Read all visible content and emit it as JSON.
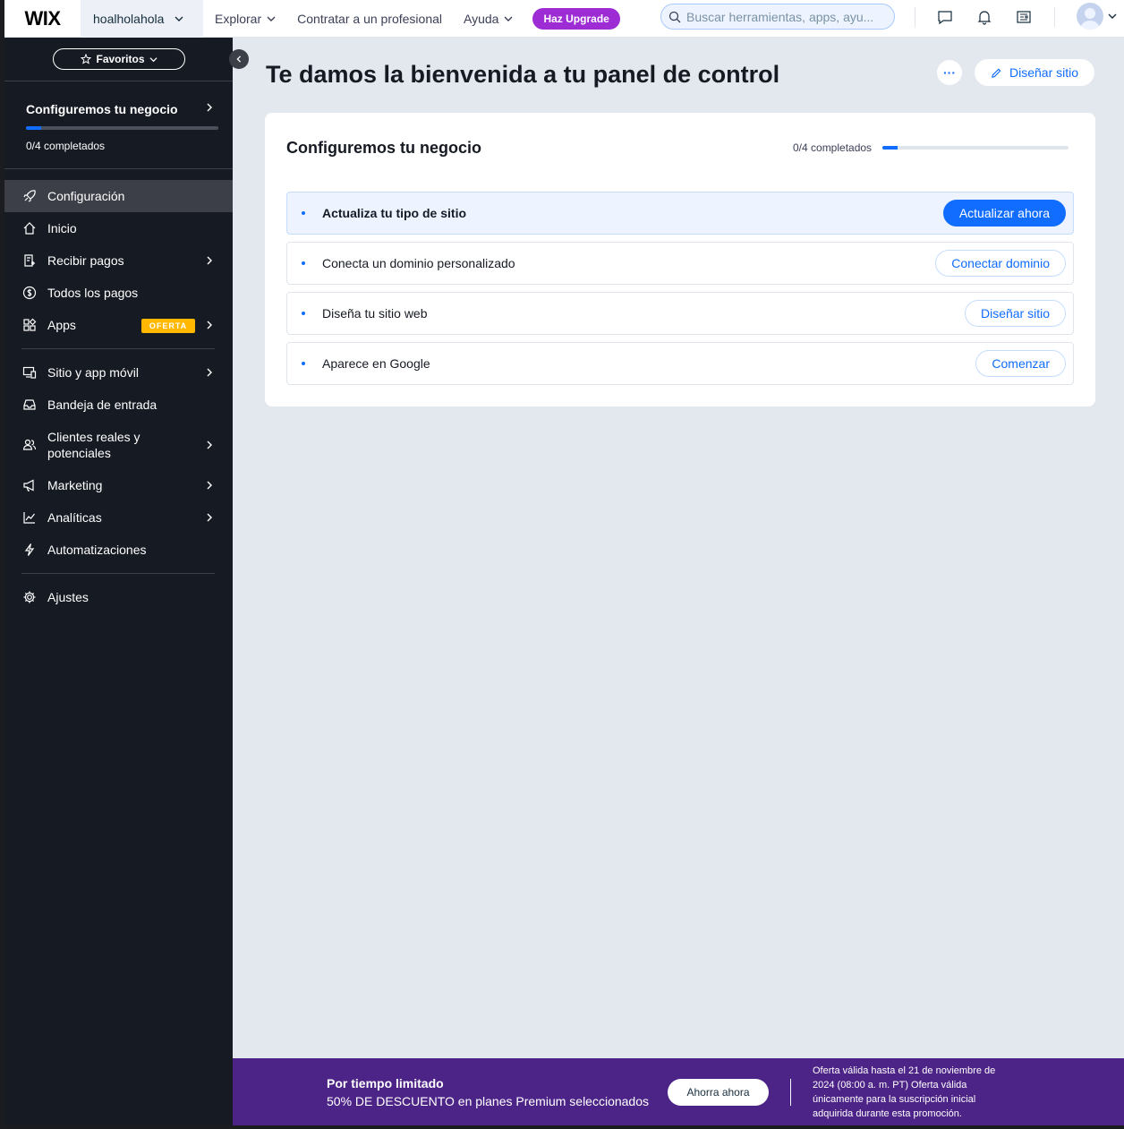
{
  "topbar": {
    "logo": "WIX",
    "site_name": "hoalholahola",
    "nav": [
      "Explorar",
      "Contratar a un profesional",
      "Ayuda"
    ],
    "upgrade_label": "Haz Upgrade",
    "search_placeholder": "Buscar herramientas, apps, ayu..."
  },
  "sidebar": {
    "favorites_label": "Favoritos",
    "setup_title": "Configuremos tu negocio",
    "setup_count": "0/4 completados",
    "setup_progress": 0.08,
    "items": [
      {
        "label": "Configuración",
        "icon": "rocket-icon",
        "active": true,
        "arrow": false
      },
      {
        "label": "Inicio",
        "icon": "home-icon",
        "arrow": false
      },
      {
        "label": "Recibir pagos",
        "icon": "payment-icon",
        "arrow": true
      },
      {
        "label": "Todos los pagos",
        "icon": "dollar-icon",
        "arrow": false
      },
      {
        "label": "Apps",
        "icon": "apps-icon",
        "arrow": true,
        "badge": "OFERTA"
      },
      {
        "label": "Sitio y app móvil",
        "icon": "devices-icon",
        "arrow": true
      },
      {
        "label": "Bandeja de entrada",
        "icon": "inbox-icon",
        "arrow": false
      },
      {
        "label": "Clientes reales y potenciales",
        "icon": "clients-icon",
        "arrow": true
      },
      {
        "label": "Marketing",
        "icon": "megaphone-icon",
        "arrow": true
      },
      {
        "label": "Analíticas",
        "icon": "analytics-icon",
        "arrow": true
      },
      {
        "label": "Automatizaciones",
        "icon": "bolt-icon",
        "arrow": false
      },
      {
        "label": "Ajustes",
        "icon": "gear-icon",
        "arrow": false
      }
    ]
  },
  "main": {
    "title": "Te damos la bienvenida a tu panel de control",
    "more_label": "···",
    "design_button": "Diseñar sitio",
    "card": {
      "title": "Configuremos tu negocio",
      "count": "0/4 completados",
      "progress": 0.08,
      "tasks": [
        {
          "label": "Actualiza tu tipo de sitio",
          "button": "Actualizar ahora",
          "primary": true
        },
        {
          "label": "Conecta un dominio personalizado",
          "button": "Conectar dominio",
          "primary": false
        },
        {
          "label": "Diseña tu sitio web",
          "button": "Diseñar sitio",
          "primary": false
        },
        {
          "label": "Aparece en Google",
          "button": "Comenzar",
          "primary": false
        }
      ]
    }
  },
  "promo": {
    "title": "Por tiempo limitado",
    "subtitle": "50% DE DESCUENTO en planes Premium seleccionados",
    "button": "Ahorra ahora",
    "legal": "Oferta válida hasta el 21 de noviembre de 2024 (08:00 a. m. PT) Oferta válida únicamente para la suscripción inicial adquirida durante esta promoción."
  },
  "colors": {
    "accent": "#116dff",
    "upgrade": "#9e2cd4",
    "sidebar_bg": "#161a23",
    "promo_bg": "#4c2386",
    "badge": "#ffb700"
  }
}
